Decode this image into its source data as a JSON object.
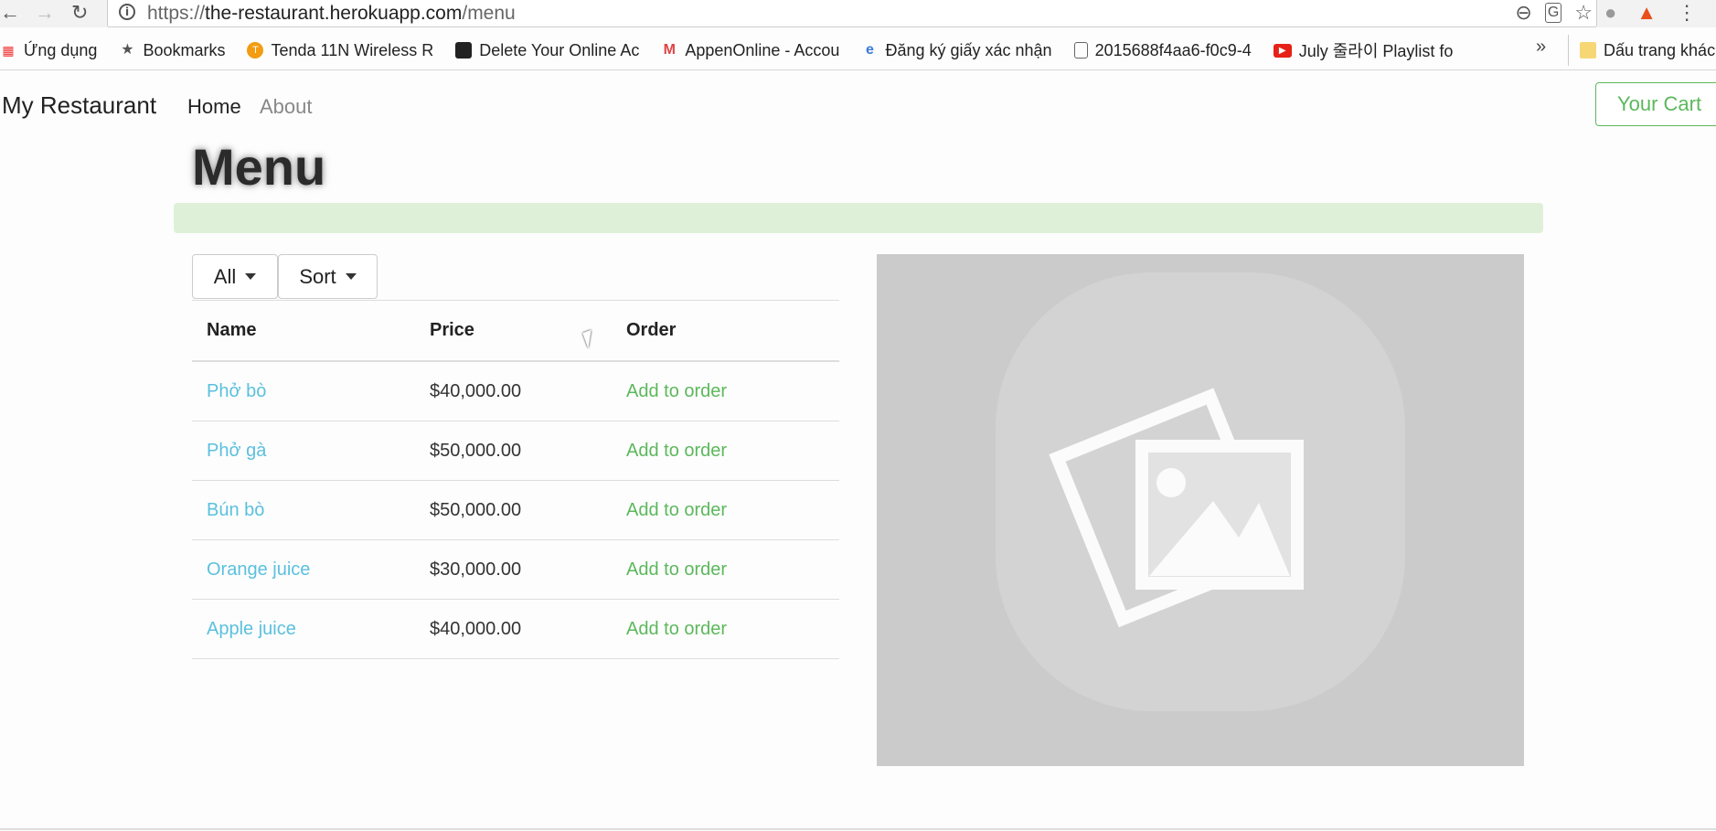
{
  "browser": {
    "url_scheme": "https://",
    "url_host": "the-restaurant.herokuapp.com",
    "url_path": "/menu",
    "bookmarks": [
      {
        "label": "Ứng dụng",
        "icon": "apps-grid-icon"
      },
      {
        "label": "Bookmarks",
        "icon": "star-icon"
      },
      {
        "label": "Tenda 11N Wireless R",
        "icon": "tenda-icon"
      },
      {
        "label": "Delete Your Online Ac",
        "icon": "site-icon"
      },
      {
        "label": "AppenOnline - Accou",
        "icon": "gmail-icon"
      },
      {
        "label": "Đăng ký giấy xác nhận",
        "icon": "ie-icon"
      },
      {
        "label": "2015688f4aa6-f0c9-4",
        "icon": "file-icon"
      },
      {
        "label": "July 줄라이 Playlist fo",
        "icon": "youtube-icon"
      }
    ],
    "bookmarks_more": "»",
    "bookmarks_folder": "Dấu trang khác"
  },
  "navbar": {
    "brand": "My Restaurant",
    "links": [
      "Home",
      "About"
    ],
    "cart": "Your Cart"
  },
  "page": {
    "title": "Menu",
    "filter_label": "All",
    "sort_label": "Sort"
  },
  "table": {
    "headers": [
      "Name",
      "Price",
      "Order"
    ],
    "rows": [
      {
        "name": "Phở bò",
        "price": "$40,000.00",
        "order": "Add to order"
      },
      {
        "name": "Phở gà",
        "price": "$50,000.00",
        "order": "Add to order"
      },
      {
        "name": "Bún bò",
        "price": "$50,000.00",
        "order": "Add to order"
      },
      {
        "name": "Orange juice",
        "price": "$30,000.00",
        "order": "Add to order"
      },
      {
        "name": "Apple juice",
        "price": "$40,000.00",
        "order": "Add to order"
      }
    ]
  },
  "colors": {
    "link": "#5bc0de",
    "success": "#5cb85c",
    "alert_bg": "#dff0d8",
    "placeholder_bg": "#cbcbcb"
  },
  "image_placeholder": {
    "icon": "image-placeholder-icon"
  }
}
